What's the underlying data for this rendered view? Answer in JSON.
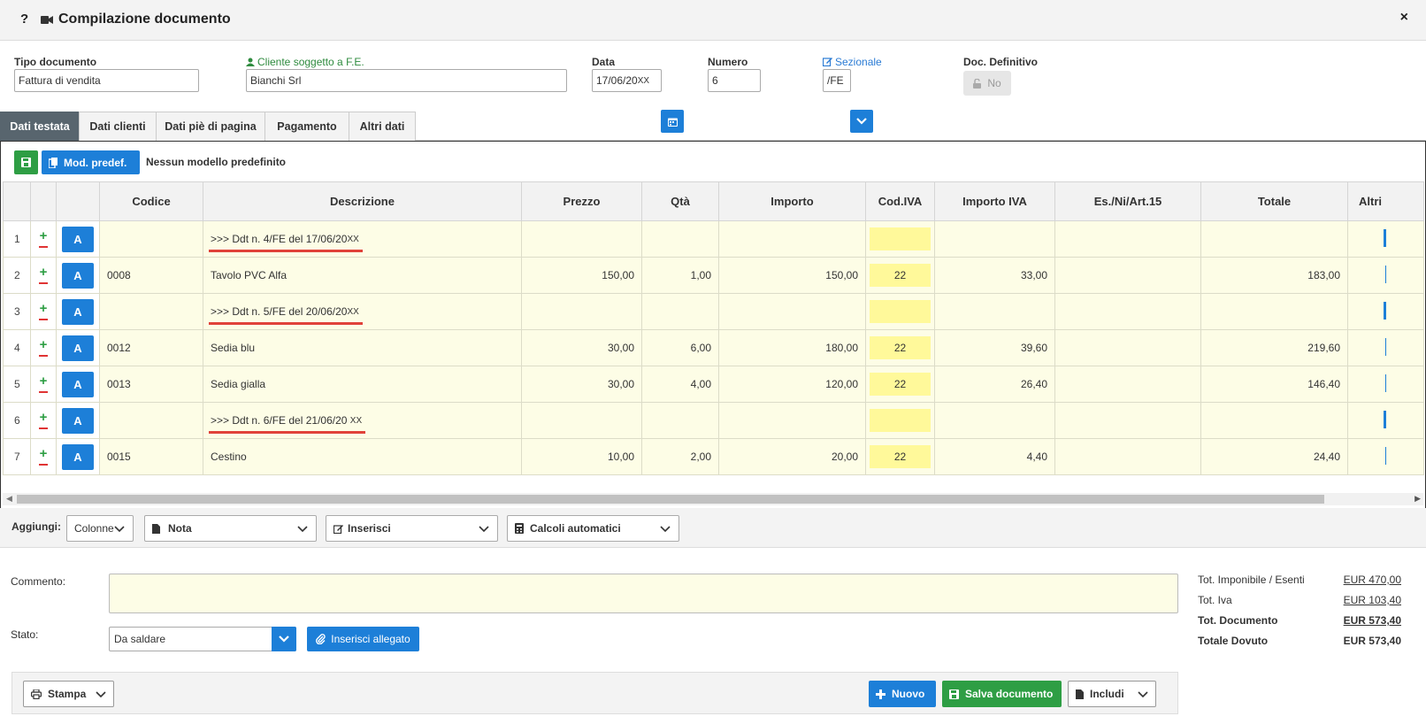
{
  "title": {
    "help": "?",
    "text": "Compilazione documento",
    "close": "×"
  },
  "header": {
    "tipo_label": "Tipo documento",
    "tipo_value": "Fattura di vendita",
    "cliente_label": "Cliente soggetto a F.E.",
    "cliente_value": "Bianchi Srl",
    "data_label": "Data",
    "data_value": "17/06/20",
    "data_xx": "XX",
    "numero_label": "Numero",
    "numero_value": "6",
    "sezionale_label": "Sezionale",
    "sezionale_value": "/FE",
    "definitivo_label": "Doc. Definitivo",
    "definitivo_value": "No"
  },
  "tabs": [
    "Dati testata",
    "Dati clienti",
    "Dati piè di pagina",
    "Pagamento",
    "Altri dati"
  ],
  "toolbar": {
    "mod_label": "Mod. predef.",
    "model_text": "Nessun modello predefinito"
  },
  "grid": {
    "columns": [
      "",
      "",
      "",
      "Codice",
      "Descrizione",
      "Prezzo",
      "Qtà",
      "Importo",
      "Cod.IVA",
      "Importo IVA",
      "Es./Ni/Art.15",
      "Totale",
      "Altri"
    ],
    "a_label": "A",
    "rows": [
      {
        "n": "1",
        "codice": "",
        "descrizione": ">>> Ddt n. 4/FE del 17/06/20",
        "xx": "XX",
        "prezzo": "",
        "qta": "",
        "importo": "",
        "iva": "",
        "importo_iva": "",
        "es": "",
        "totale": ""
      },
      {
        "n": "2",
        "codice": "0008",
        "descrizione": "Tavolo PVC Alfa",
        "xx": "",
        "prezzo": "150,00",
        "qta": "1,00",
        "importo": "150,00",
        "iva": "22",
        "importo_iva": "33,00",
        "es": "",
        "totale": "183,00"
      },
      {
        "n": "3",
        "codice": "",
        "descrizione": ">>> Ddt n. 5/FE del 20/06/20",
        "xx": "XX",
        "prezzo": "",
        "qta": "",
        "importo": "",
        "iva": "",
        "importo_iva": "",
        "es": "",
        "totale": ""
      },
      {
        "n": "4",
        "codice": "0012",
        "descrizione": "Sedia blu",
        "xx": "",
        "prezzo": "30,00",
        "qta": "6,00",
        "importo": "180,00",
        "iva": "22",
        "importo_iva": "39,60",
        "es": "",
        "totale": "219,60"
      },
      {
        "n": "5",
        "codice": "0013",
        "descrizione": "Sedia gialla",
        "xx": "",
        "prezzo": "30,00",
        "qta": "4,00",
        "importo": "120,00",
        "iva": "22",
        "importo_iva": "26,40",
        "es": "",
        "totale": "146,40"
      },
      {
        "n": "6",
        "codice": "",
        "descrizione": ">>> Ddt n. 6/FE del 21/06/20",
        "xx": "XX",
        "prezzo": "",
        "qta": "",
        "importo": "",
        "iva": "",
        "importo_iva": "",
        "es": "",
        "totale": ""
      },
      {
        "n": "7",
        "codice": "0015",
        "descrizione": "Cestino",
        "xx": "",
        "prezzo": "10,00",
        "qta": "2,00",
        "importo": "20,00",
        "iva": "22",
        "importo_iva": "4,40",
        "es": "",
        "totale": "24,40"
      }
    ]
  },
  "aggiungi": {
    "label": "Aggiungi:",
    "colonne": "Colonne",
    "nota": "Nota",
    "inserisci": "Inserisci",
    "calcoli": "Calcoli automatici"
  },
  "bottom": {
    "commento_label": "Commento:",
    "commento_value": "",
    "stato_label": "Stato:",
    "stato_value": "Da saldare",
    "allegato_label": "Inserisci allegato"
  },
  "totals": [
    {
      "label": "Tot. Imponibile / Esenti",
      "value": "EUR 470,00"
    },
    {
      "label": "Tot. Iva",
      "value": "EUR 103,40"
    },
    {
      "label": "Tot. Documento",
      "value": "EUR 573,40"
    },
    {
      "label": "Totale Dovuto",
      "value": "EUR 573,40"
    }
  ],
  "footer": {
    "stampa": "Stampa",
    "nuovo": "Nuovo",
    "salva": "Salva documento",
    "includi": "Includi"
  },
  "colors": {
    "blue": "#1d7fd8",
    "green": "#2e9e44",
    "row_bg": "#fdfde6",
    "iva_bg": "#fff99a",
    "tab_active": "#58656e",
    "underline_red": "#e0423a"
  }
}
